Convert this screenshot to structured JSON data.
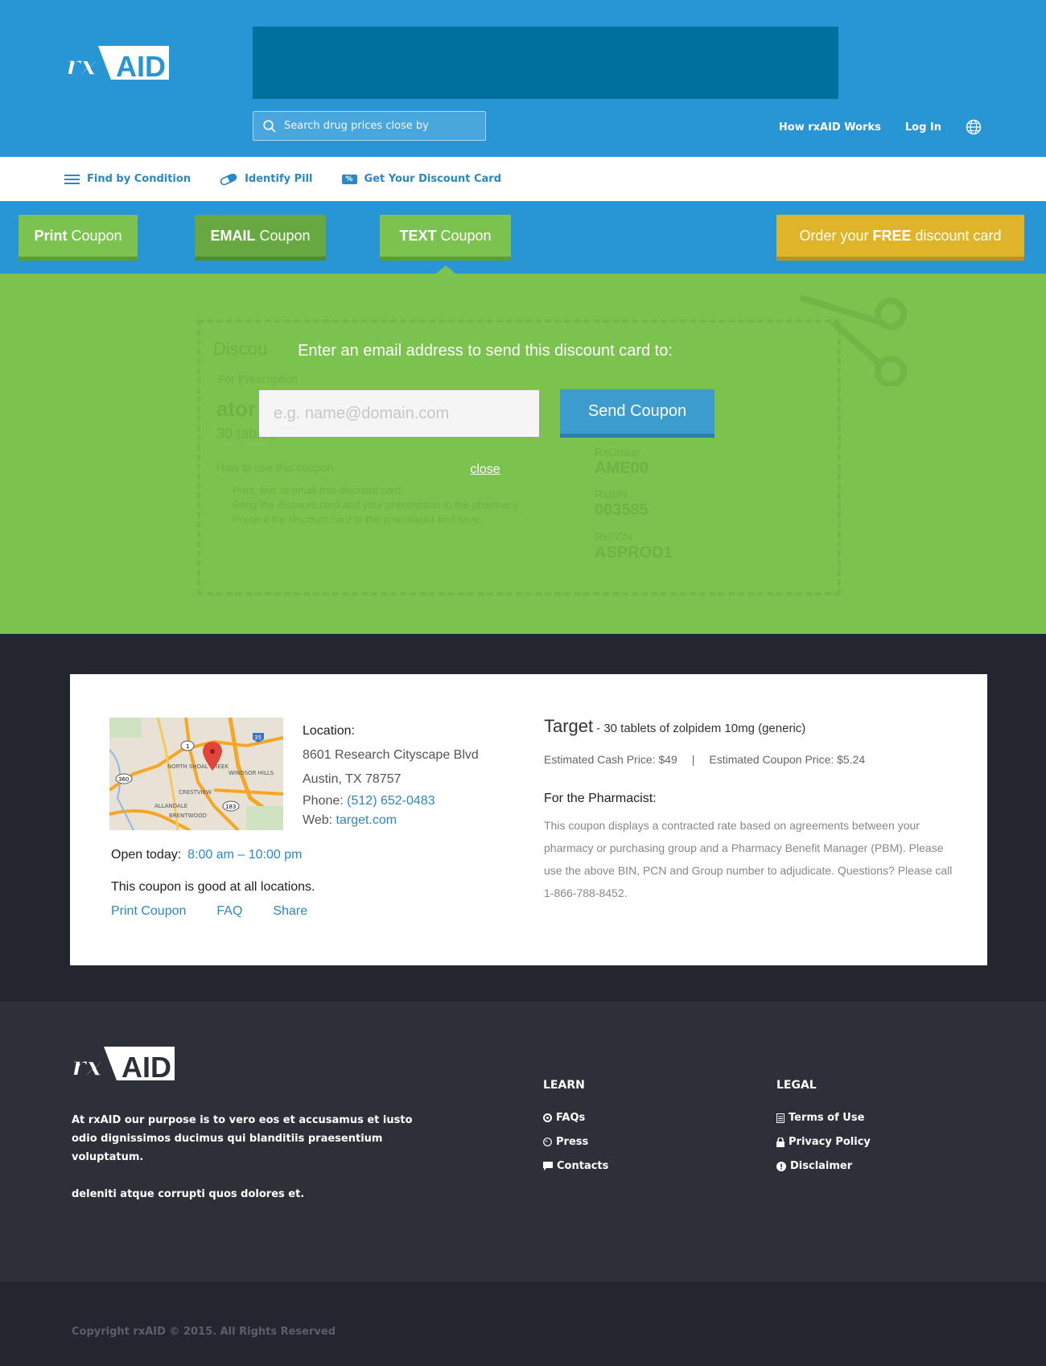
{
  "header": {
    "logo_text": "rxAID",
    "search_placeholder": "Search drug prices close by",
    "how_link": "How rxAID Works",
    "login_link": "Log In"
  },
  "subnav": {
    "find_condition": "Find by Condition",
    "identify_pill": "Identify Pill",
    "discount_badge": "%",
    "discount_card": "Get Your Discount Card"
  },
  "actions": {
    "print_bold": "Print",
    "print_rest": "Coupon",
    "email_bold": "EMAIL",
    "email_rest": "Coupon",
    "text_bold": "TEXT",
    "text_rest": "Coupon",
    "order_pre": "Order your",
    "order_bold": "FREE",
    "order_post": "discount card"
  },
  "modal": {
    "title": "Enter an email address to send this discount card to:",
    "email_placeholder": "e.g. name@domain.com",
    "send_label": "Send Coupon",
    "close_label": "close"
  },
  "ghost_coupon": {
    "title": "Discou",
    "l1": "For Prescription",
    "drug": "ator",
    "qty": "30 tablets",
    "how": "How to use this coupon",
    "steps": [
      "Print, text or email this discount card.",
      "Bring the discount card and your prescription to the pharmacy.",
      "Present the discount card to the pharmacist and save."
    ],
    "group_label": "RxGroup",
    "group_value": "AME00",
    "bin_label": "RxBIN",
    "bin_value": "003585",
    "pcn_label": "RxPCN",
    "pcn_value": "ASPROD1"
  },
  "location": {
    "label": "Location:",
    "address1": "8601 Research Cityscape Blvd",
    "address2": "Austin, TX 78757",
    "phone_label": "Phone:",
    "phone": "(512) 652-0483",
    "web_label": "Web:",
    "web": "target.com",
    "open_label": "Open today:",
    "open_hours": "8:00 am – 10:00 pm",
    "good_text": "This coupon is good at all locations.",
    "links": [
      "Print Coupon",
      "FAQ",
      "Share"
    ],
    "map_labels": [
      "NORTH SHOAL CREEK",
      "WINDSOR HILLS",
      "CRESTVIEW",
      "ALLANDALE",
      "BRENTWOOD",
      "360",
      "1",
      "35",
      "183"
    ]
  },
  "pricing": {
    "store": "Target",
    "desc": "- 30 tablets of zolpidem 10mg (generic)",
    "cash": "Estimated Cash Price: $49",
    "sep": "|",
    "coupon": "Estimated Coupon Price: $5.24",
    "pharm_title": "For the Pharmacist:",
    "pharm_text": "This coupon displays a contracted rate based on agreements between your pharmacy or purchasing group and a Pharmacy Benefit Manager (PBM). Please use the above BIN, PCN and Group number to adjudicate. Questions? Please call 1-866-788-8452."
  },
  "footer": {
    "about1": "At rxAID our purpose is to vero eos et accusamus et iusto odio dignissimos ducimus qui blanditiis praesentium voluptatum.",
    "about2": "deleniti atque corrupti quos dolores et.",
    "learn_title": "LEARN",
    "learn": [
      "FAQs",
      "Press",
      "Contacts"
    ],
    "legal_title": "LEGAL",
    "legal": [
      "Terms of Use",
      "Privacy Policy",
      "Disclaimer"
    ],
    "copyright": "Copyright rxAID © 2015. All Rights Reserved"
  },
  "colors": {
    "header_blue": "#2896d5",
    "green": "#7bc24f",
    "gold": "#dfb428",
    "link_blue": "#2a88c8",
    "dark": "#23262e"
  }
}
